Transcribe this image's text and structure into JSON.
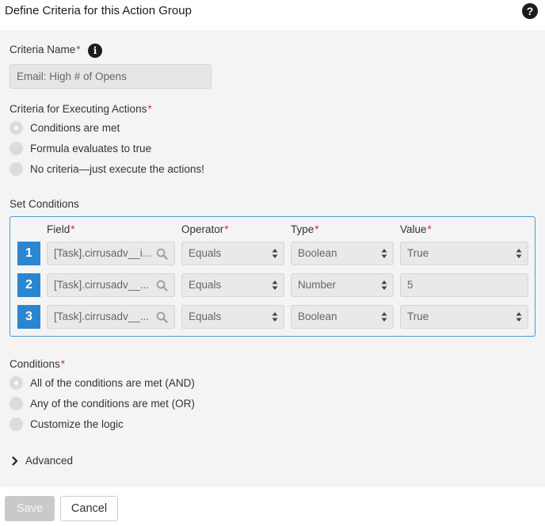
{
  "header": {
    "title": "Define Criteria for this Action Group",
    "help_icon": "?"
  },
  "criteria_name": {
    "label": "Criteria Name",
    "required": "*",
    "info_icon": "i",
    "value": "Email: High # of Opens"
  },
  "executing": {
    "label": "Criteria for Executing Actions",
    "required": "*",
    "options": [
      {
        "label": "Conditions are met",
        "selected": true
      },
      {
        "label": "Formula evaluates to true",
        "selected": false
      },
      {
        "label": "No criteria—just execute the actions!",
        "selected": false
      }
    ]
  },
  "set_conditions": {
    "label": "Set Conditions",
    "columns": {
      "field": "Field",
      "operator": "Operator",
      "type": "Type",
      "value": "Value",
      "required": "*"
    },
    "rows": [
      {
        "num": "1",
        "field": "[Task].cirrusadv__i...",
        "operator": "Equals",
        "type": "Boolean",
        "value": "True"
      },
      {
        "num": "2",
        "field": "[Task].cirrusadv__...",
        "operator": "Equals",
        "type": "Number",
        "value": "5"
      },
      {
        "num": "3",
        "field": "[Task].cirrusadv__...",
        "operator": "Equals",
        "type": "Boolean",
        "value": "True"
      }
    ]
  },
  "conditions": {
    "label": "Conditions",
    "required": "*",
    "options": [
      {
        "label": "All of the conditions are met (AND)",
        "selected": true
      },
      {
        "label": "Any of the conditions are met (OR)",
        "selected": false
      },
      {
        "label": "Customize the logic",
        "selected": false
      }
    ]
  },
  "advanced": {
    "label": "Advanced"
  },
  "footer": {
    "save_label": "Save",
    "cancel_label": "Cancel"
  },
  "colors": {
    "accent": "#2a86d1",
    "required": "#c23934",
    "panel_bg": "#f4f4f4",
    "disabled_button": "#c9c9c9"
  }
}
